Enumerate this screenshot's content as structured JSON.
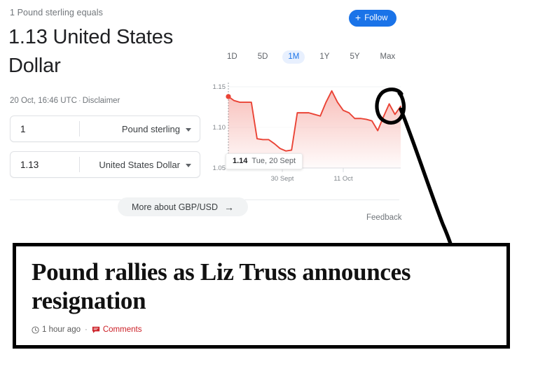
{
  "panel": {
    "subtitle": "1 Pound sterling equals",
    "headline": "1.13 United States Dollar",
    "timestamp": "20 Oct, 16:46 UTC",
    "separator": "·",
    "disclaimer": "Disclaimer",
    "follow_label": "Follow",
    "follow_icon": "plus-icon",
    "more_about_label": "More about GBP/USD",
    "more_about_icon": "arrow-right-icon",
    "feedback_label": "Feedback"
  },
  "converter": {
    "from": {
      "amount": "1",
      "currency": "Pound sterling",
      "caret_icon": "chevron-down-icon"
    },
    "to": {
      "amount": "1.13",
      "currency": "United States Dollar",
      "caret_icon": "chevron-down-icon"
    }
  },
  "chart": {
    "tabs": [
      {
        "label": "1D",
        "selected": false
      },
      {
        "label": "5D",
        "selected": false
      },
      {
        "label": "1M",
        "selected": true
      },
      {
        "label": "1Y",
        "selected": false
      },
      {
        "label": "5Y",
        "selected": false
      },
      {
        "label": "Max",
        "selected": false
      }
    ],
    "tooltip": {
      "value": "1.14",
      "date": "Tue, 20 Sept"
    },
    "line_color": "#EA4335",
    "accent_color": "#1a73e8"
  },
  "chart_data": {
    "type": "line",
    "title": "GBP/USD 1 Month",
    "xlabel": "",
    "ylabel": "",
    "ylim": [
      1.05,
      1.15
    ],
    "yticks": [
      1.05,
      1.1,
      1.15
    ],
    "ytick_labels": [
      "1.05",
      "1.10",
      "1.15"
    ],
    "xticks": [
      "30 Sept",
      "11 Oct"
    ],
    "grid": false,
    "legend": "none",
    "series": [
      {
        "name": "GBP/USD",
        "x": [
          "20 Sept",
          "21 Sept",
          "22 Sept",
          "23 Sept",
          "24 Sept",
          "25 Sept",
          "26 Sept",
          "27 Sept",
          "28 Sept",
          "29 Sept",
          "30 Sept",
          "1 Oct",
          "2 Oct",
          "3 Oct",
          "4 Oct",
          "5 Oct",
          "6 Oct",
          "7 Oct",
          "8 Oct",
          "9 Oct",
          "10 Oct",
          "11 Oct",
          "12 Oct",
          "13 Oct",
          "14 Oct",
          "15 Oct",
          "16 Oct",
          "17 Oct",
          "18 Oct",
          "19 Oct",
          "20 Oct"
        ],
        "values": [
          1.138,
          1.133,
          1.131,
          1.131,
          1.131,
          1.086,
          1.085,
          1.085,
          1.08,
          1.074,
          1.071,
          1.072,
          1.118,
          1.118,
          1.118,
          1.116,
          1.114,
          1.131,
          1.145,
          1.131,
          1.121,
          1.118,
          1.111,
          1.111,
          1.11,
          1.108,
          1.096,
          1.113,
          1.129,
          1.116,
          1.126
        ]
      }
    ],
    "marker": {
      "x": "20 Sept",
      "y": 1.138,
      "color": "#EA4335"
    }
  },
  "annotation": {
    "circle_label": "hand-drawn-circle",
    "line_label": "hand-drawn-pointer-line",
    "color": "#000000"
  },
  "news": {
    "headline": "Pound rallies as Liz Truss announces resignation",
    "time_icon": "clock-icon",
    "time_text": "1 hour ago",
    "separator": "·",
    "comments_icon": "comment-icon",
    "comments_text": "Comments"
  }
}
